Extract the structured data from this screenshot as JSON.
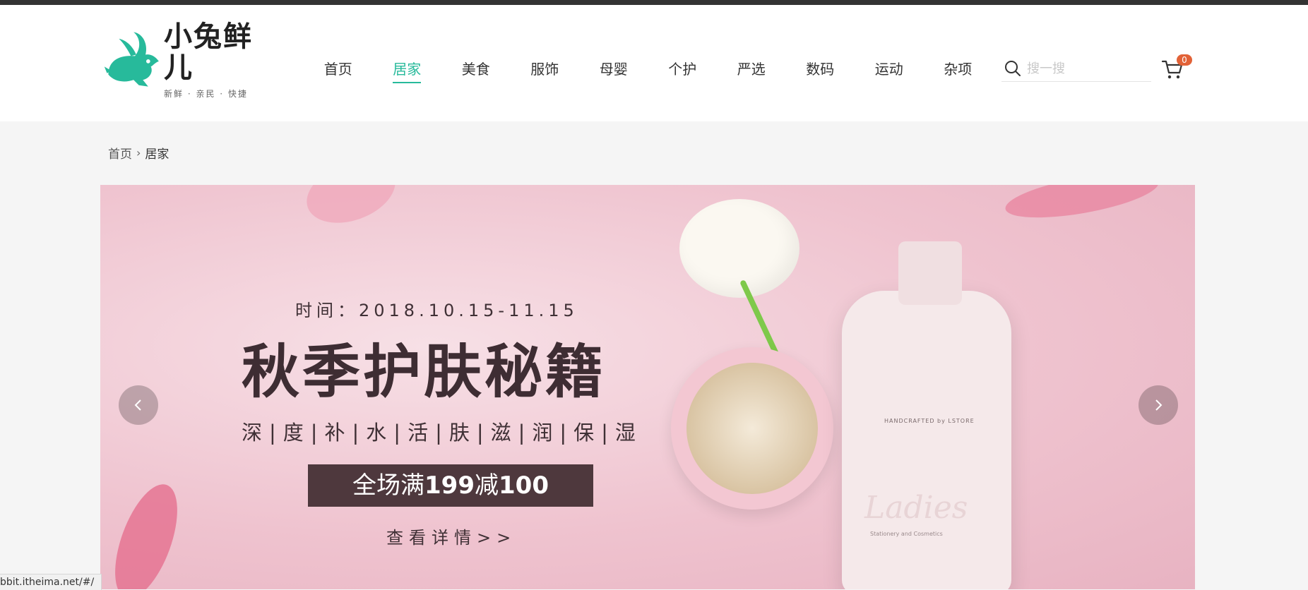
{
  "header": {
    "logo": {
      "title": "小兔鲜儿",
      "slogan": "新鲜 · 亲民 · 快捷",
      "colors": {
        "rabbit": "#27ba9b"
      }
    },
    "nav": [
      {
        "label": "首页",
        "active": false
      },
      {
        "label": "居家",
        "active": true
      },
      {
        "label": "美食",
        "active": false
      },
      {
        "label": "服饰",
        "active": false
      },
      {
        "label": "母婴",
        "active": false
      },
      {
        "label": "个护",
        "active": false
      },
      {
        "label": "严选",
        "active": false
      },
      {
        "label": "数码",
        "active": false
      },
      {
        "label": "运动",
        "active": false
      },
      {
        "label": "杂项",
        "active": false
      }
    ],
    "search": {
      "placeholder": "搜一搜",
      "value": "",
      "icon": "search-icon"
    },
    "cart": {
      "icon": "cart-icon",
      "count": "0"
    },
    "accent_color": "#27ba9b",
    "badge_color": "#e26237"
  },
  "breadcrumb": {
    "items": [
      "首页",
      "居家"
    ],
    "separator_icon": "chevron-right-icon"
  },
  "banner": {
    "time": "时间：2018.10.15-11.15",
    "title": "秋季护肤秘籍",
    "subtitle": "深|度|补|水|活|肤|滋|润|保|湿",
    "promo_prefix": "全场满",
    "promo_num1": "199",
    "promo_mid": "减",
    "promo_num2": "100",
    "more": "查看详情>>",
    "bottle_brand": "HANDCRAFTED by LSTORE",
    "bottle_label": "Ladies",
    "bottle_sub": "Stationery and Cosmetics",
    "prev_icon": "chevron-left-icon",
    "next_icon": "chevron-right-icon"
  },
  "status_url": "bbit.itheima.net/#/"
}
